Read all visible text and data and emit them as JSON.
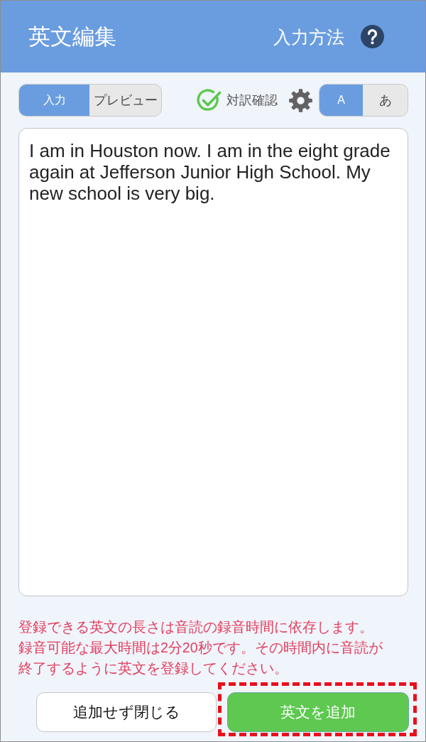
{
  "header": {
    "title": "英文編集",
    "help_link": "入力方法"
  },
  "toolbar": {
    "mode_tabs": [
      {
        "label": "入力",
        "selected": true
      },
      {
        "label": "プレビュー",
        "selected": false
      }
    ],
    "translation_check": {
      "label": "対訳確認",
      "checked": true
    },
    "script_tabs": [
      {
        "label": "A",
        "selected": true
      },
      {
        "label": "あ",
        "selected": false
      }
    ]
  },
  "editor": {
    "value": "I am in Houston now. I am in the eight grade again at Jefferson Junior High School. My new school is very big."
  },
  "notice": [
    "登録できる英文の長さは音読の録音時間に依存します。",
    "録音可能な最大時間は2分20秒です。その時間内に音読が終了するように英文を登録してください。"
  ],
  "buttons": [
    {
      "label": "追加せず閉じる",
      "kind": "secondary",
      "highlighted": false
    },
    {
      "label": "英文を追加",
      "kind": "primary",
      "highlighted": true
    }
  ]
}
